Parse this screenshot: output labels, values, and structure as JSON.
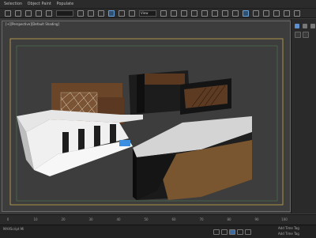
{
  "menu": {
    "items": [
      "Selection",
      "Object Paint",
      "Populate"
    ]
  },
  "toolbar": {
    "view_value": "View"
  },
  "viewport": {
    "label": "[+][Perspective][Default Shading]"
  },
  "timeline": {
    "frames": [
      "0",
      "10",
      "20",
      "30",
      "40",
      "50",
      "60",
      "70",
      "80",
      "90",
      "100"
    ]
  },
  "status": {
    "left_text": "MAXScript Mi",
    "right_top": "Add Time Tag",
    "right_bottom": "Add Time Tag"
  },
  "colors": {
    "viewport_bg": "#3d3d3d",
    "safe_frame_outer": "#c9a94a",
    "safe_frame_inner": "#4f7f56",
    "wood": "#6b4528",
    "wall_white": "#e6e6e6",
    "counter_black": "#1d1d1d",
    "accent_blue": "#3c8fe0"
  }
}
